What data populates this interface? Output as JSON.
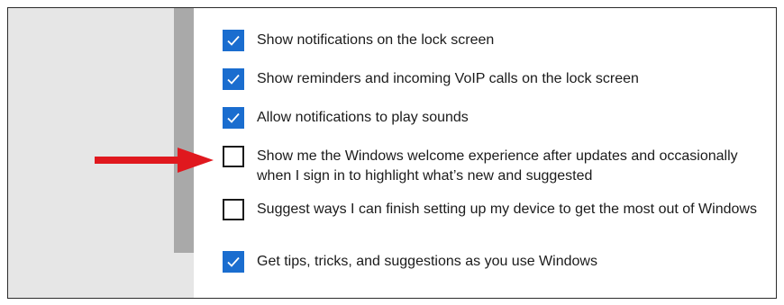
{
  "settings": {
    "items": [
      {
        "label": "Show notifications on the lock screen",
        "checked": true
      },
      {
        "label": "Show reminders and incoming VoIP calls on the lock screen",
        "checked": true
      },
      {
        "label": "Allow notifications to play sounds",
        "checked": true
      },
      {
        "label": "Show me the Windows welcome experience after updates and occasionally when I sign in to highlight what’s new and suggested",
        "checked": false
      },
      {
        "label": "Suggest ways I can finish setting up my device to get the most out of Windows",
        "checked": false
      },
      {
        "label": "Get tips, tricks, and suggestions as you use Windows",
        "checked": true
      }
    ]
  },
  "colors": {
    "accent": "#1a6dcf",
    "arrow": "#e0181e",
    "left_pane": "#e6e6e6",
    "scrollbar": "#a9a9a9"
  },
  "icons": {
    "checkmark": "checkmark-icon",
    "pointer": "red-arrow-icon"
  }
}
